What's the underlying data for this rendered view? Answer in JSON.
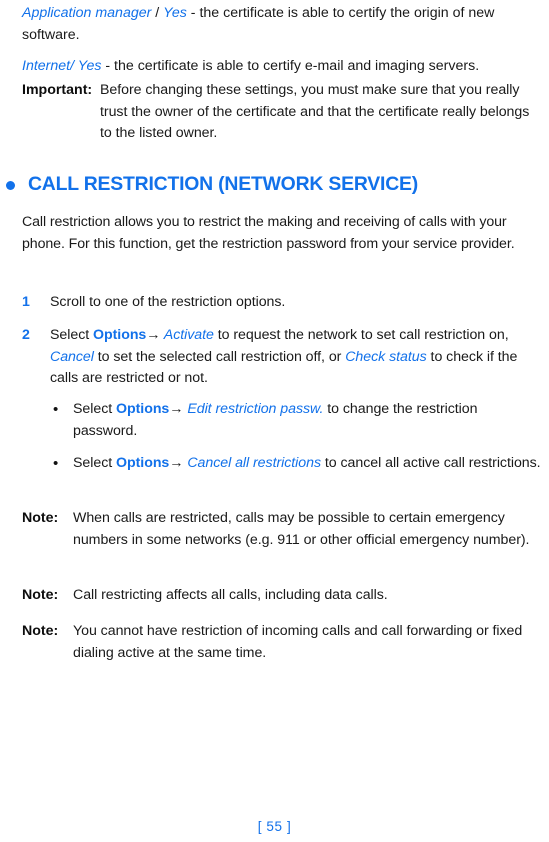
{
  "document": {
    "page_number": "[ 55 ]"
  },
  "cert_lines": [
    {
      "link1": "Application manager",
      "sep": " / ",
      "link2": "Yes",
      "rest": " - the certificate is able to certify the origin of new software."
    },
    {
      "link1": "Internet",
      "sep": "/",
      "link2": " Yes",
      "rest": " - the certificate is able to certify e-mail and imaging servers."
    }
  ],
  "important": {
    "label": "Important:",
    "body": "Before changing these settings, you must make sure that you really trust the owner of the certificate and that the certificate really belongs to the listed owner."
  },
  "section": {
    "bullet": "section-bullet-dot",
    "title": "CALL RESTRICTION (NETWORK SERVICE)",
    "accent_color": "#1271ea"
  },
  "intro": "Call restriction allows you to restrict the making and receiving of calls with your phone. For this function, get the restriction password from your service provider.",
  "steps": [
    {
      "number": "1",
      "text": "Scroll to one of the restriction options."
    },
    {
      "number": "2",
      "lead": "Select ",
      "menu": "Options",
      "arrow": "→",
      "item1": " Activate",
      "mid1": " to request the network to set call restriction on, ",
      "item2": "Cancel",
      "mid2": " to set the selected call restriction off, or ",
      "item3": "Check status",
      "tail": " to check if the calls are restricted or not."
    }
  ],
  "sub_bullets": [
    {
      "marker": "•",
      "lead": "Select ",
      "menu": "Options",
      "arrow": "→",
      "item": " Edit restriction passw.",
      "tail": " to change the restriction password."
    },
    {
      "marker": "•",
      "lead": "Select ",
      "menu": "Options",
      "arrow": "→",
      "item": " Cancel all restrictions",
      "tail": " to cancel all active call restrictions."
    }
  ],
  "notes": [
    {
      "label": "Note:",
      "body": "When calls are restricted, calls may be possible to certain emergency numbers in some networks (e.g. 911 or other official emergency number)."
    },
    {
      "label": "Note:",
      "body": "Call restricting affects all calls, including data calls."
    },
    {
      "label": "Note:",
      "body": "You cannot have restriction of incoming calls and call forwarding or fixed dialing active at the same time."
    }
  ]
}
